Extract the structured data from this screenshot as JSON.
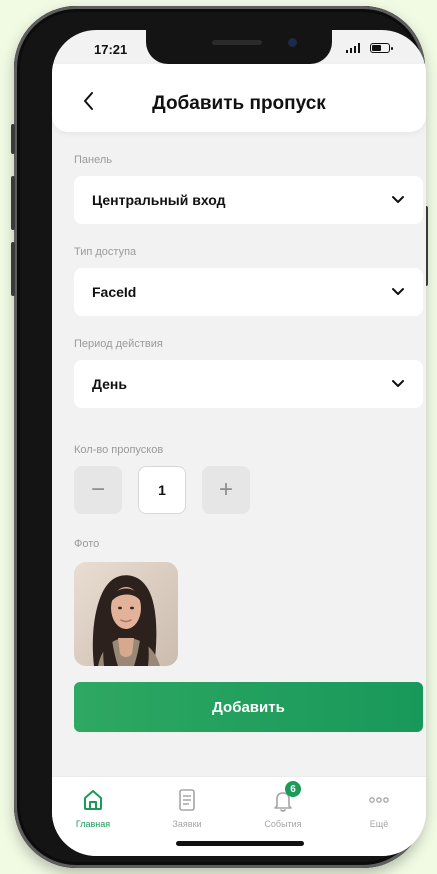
{
  "status_bar": {
    "time": "17:21"
  },
  "header": {
    "title": "Добавить пропуск"
  },
  "form": {
    "panel": {
      "label": "Панель",
      "value": "Центральный вход"
    },
    "access_type": {
      "label": "Тип доступа",
      "value": "FaceId"
    },
    "validity_period": {
      "label": "Период действия",
      "value": "День"
    },
    "pass_count": {
      "label": "Кол-во пропусков",
      "value": "1",
      "decrement": "−",
      "increment": "+"
    },
    "photo": {
      "label": "Фото"
    }
  },
  "submit": {
    "label": "Добавить"
  },
  "tabbar": {
    "items": [
      {
        "label": "Главная",
        "icon": "home-icon",
        "active": true
      },
      {
        "label": "Заявки",
        "icon": "document-icon",
        "active": false
      },
      {
        "label": "События",
        "icon": "bell-icon",
        "active": false,
        "badge": "6"
      },
      {
        "label": "Ещё",
        "icon": "more-icon",
        "active": false
      }
    ]
  },
  "colors": {
    "accent": "#1c9a58",
    "background": "#f2f2f2",
    "frame": "#141414"
  }
}
